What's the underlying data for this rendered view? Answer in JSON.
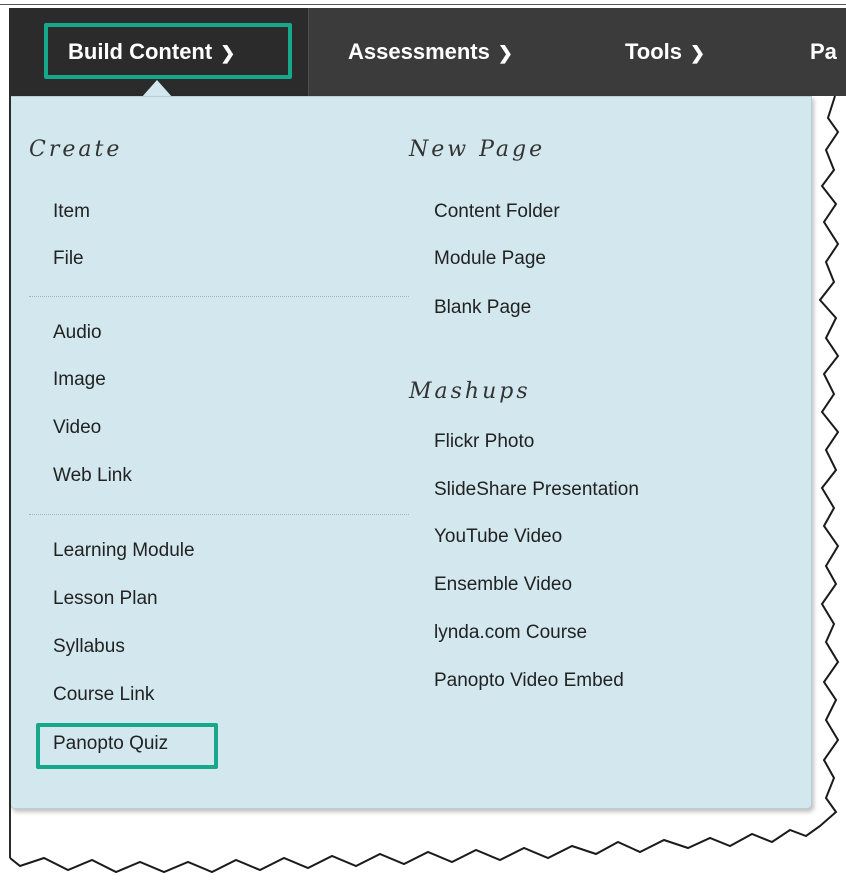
{
  "nav": {
    "build_content": "Build Content",
    "assessments": "Assessments",
    "tools": "Tools",
    "partial": "Pa"
  },
  "icons": {
    "chevron": "chevron-down-icon"
  },
  "colors": {
    "highlight": "#17a88b",
    "menu_bg": "#d2e8ee",
    "nav_bg": "#3b3b3b"
  },
  "menu": {
    "create": {
      "heading": "Create",
      "group1": [
        "Item",
        "File"
      ],
      "group2": [
        "Audio",
        "Image",
        "Video",
        "Web Link"
      ],
      "group3": [
        "Learning Module",
        "Lesson Plan",
        "Syllabus",
        "Course Link",
        "Panopto Quiz"
      ]
    },
    "new_page": {
      "heading": "New Page",
      "items": [
        "Content Folder",
        "Module Page",
        "Blank Page"
      ]
    },
    "mashups": {
      "heading": "Mashups",
      "items": [
        "Flickr Photo",
        "SlideShare Presentation",
        "YouTube Video",
        "Ensemble Video",
        "lynda.com Course",
        "Panopto Video Embed"
      ]
    }
  }
}
